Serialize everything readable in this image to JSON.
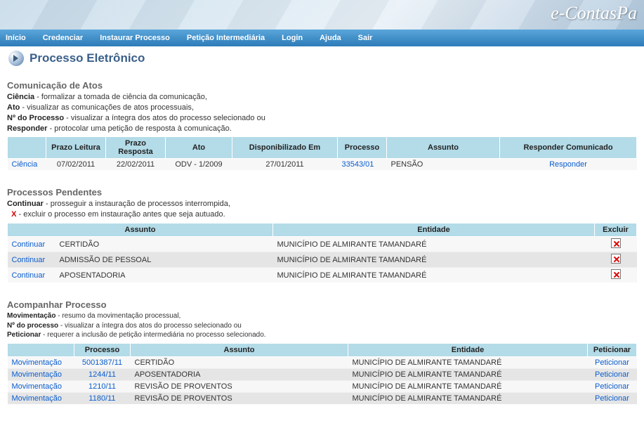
{
  "brand": "e-ContasPa",
  "nav": {
    "inicio": "Início",
    "credenciar": "Credenciar",
    "instaurar": "Instaurar Processo",
    "peticao": "Petição Intermediária",
    "login": "Login",
    "ajuda": "Ajuda",
    "sair": "Sair"
  },
  "page_title": "Processo Eletrônico",
  "comunicacao": {
    "title": "Comunicação de Atos",
    "desc": {
      "ciencia_b": "Ciência",
      "ciencia_t": " - formalizar a tomada de ciência da comunicação,",
      "ato_b": "Ato",
      "ato_t": " - visualizar as comunicações de atos processuais,",
      "nproc_b": "Nº do Processo",
      "nproc_t": " - visualizar a íntegra dos atos do processo selecionado ou",
      "resp_b": "Responder",
      "resp_t": " - protocolar uma petição de resposta à comunicação."
    },
    "headers": {
      "col0": "",
      "prazo_leitura": "Prazo Leitura",
      "prazo_resposta": "Prazo Resposta",
      "ato": "Ato",
      "disponibilizado": "Disponibilizado Em",
      "processo": "Processo",
      "assunto": "Assunto",
      "responder": "Responder Comunicado"
    },
    "rows": [
      {
        "ciencia": "Ciência",
        "prazo_leitura": "07/02/2011",
        "prazo_resposta": "22/02/2011",
        "ato": "ODV - 1/2009",
        "disponibilizado": "27/01/2011",
        "processo": "33543/01",
        "assunto": "PENSÃO",
        "responder": "Responder"
      }
    ]
  },
  "pendentes": {
    "title": "Processos Pendentes",
    "desc": {
      "continuar_b": "Continuar",
      "continuar_t": " - prosseguir a instauração de processos interrompida,",
      "x_b": "X",
      "x_t": " - excluir o processo em instauração antes que seja autuado."
    },
    "headers": {
      "assunto": "Assunto",
      "entidade": "Entidade",
      "excluir": "Excluir"
    },
    "rows": [
      {
        "continuar": "Continuar",
        "assunto": "CERTIDÃO",
        "entidade": "MUNICÍPIO DE ALMIRANTE TAMANDARÉ"
      },
      {
        "continuar": "Continuar",
        "assunto": "ADMISSÃO DE PESSOAL",
        "entidade": "MUNICÍPIO DE ALMIRANTE TAMANDARÉ"
      },
      {
        "continuar": "Continuar",
        "assunto": "APOSENTADORIA",
        "entidade": "MUNICÍPIO DE ALMIRANTE TAMANDARÉ"
      }
    ]
  },
  "acompanhar": {
    "title": "Acompanhar Processo",
    "desc": {
      "mov_b": "Movimentação",
      "mov_t": " - resumo da movimentação processual,",
      "nproc_b": "Nº do processo",
      "nproc_t": " - visualizar a íntegra dos atos do processo selecionado ou",
      "pet_b": "Peticionar",
      "pet_t": " - requerer a inclusão de petição intermediária no processo selecionado."
    },
    "headers": {
      "col0": "",
      "processo": "Processo",
      "assunto": "Assunto",
      "entidade": "Entidade",
      "peticionar": "Peticionar"
    },
    "rows": [
      {
        "mov": "Movimentação",
        "processo": "5001387/11",
        "assunto": "CERTIDÃO",
        "entidade": "MUNICÍPIO DE ALMIRANTE TAMANDARÉ",
        "pet": "Peticionar"
      },
      {
        "mov": "Movimentação",
        "processo": "1244/11",
        "assunto": "APOSENTADORIA",
        "entidade": "MUNICÍPIO DE ALMIRANTE TAMANDARÉ",
        "pet": "Peticionar"
      },
      {
        "mov": "Movimentação",
        "processo": "1210/11",
        "assunto": "REVISÃO DE PROVENTOS",
        "entidade": "MUNICÍPIO DE ALMIRANTE TAMANDARÉ",
        "pet": "Peticionar"
      },
      {
        "mov": "Movimentação",
        "processo": "1180/11",
        "assunto": "REVISÃO DE PROVENTOS",
        "entidade": "MUNICÍPIO DE ALMIRANTE TAMANDARÉ",
        "pet": "Peticionar"
      }
    ]
  }
}
